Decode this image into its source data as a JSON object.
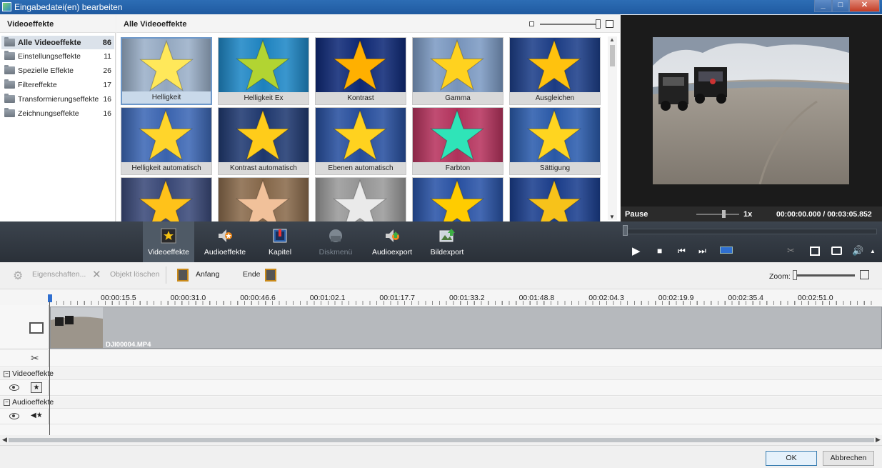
{
  "window": {
    "title": "Eingabedatei(en) bearbeiten",
    "min": "_",
    "max": "□",
    "close": "✕"
  },
  "categories": {
    "header": "Videoeffekte",
    "items": [
      {
        "label": "Alle Videoeffekte",
        "count": "86"
      },
      {
        "label": "Einstellungseffekte",
        "count": "11"
      },
      {
        "label": "Spezielle Effekte",
        "count": "26"
      },
      {
        "label": "Filtereffekte",
        "count": "17"
      },
      {
        "label": "Transformierungseffekte",
        "count": "16"
      },
      {
        "label": "Zeichnungseffekte",
        "count": "16"
      }
    ]
  },
  "grid": {
    "title": "Alle Videoeffekte",
    "tiles": [
      {
        "label": "Helligkeit",
        "bg": "#9bb0c9",
        "star": "#ffe85a"
      },
      {
        "label": "Helligkeit Ex",
        "bg": "#1f88c7",
        "star": "#b2d432"
      },
      {
        "label": "Kontrast",
        "bg": "#0f2a78",
        "star": "#ffb000"
      },
      {
        "label": "Gamma",
        "bg": "#7d9bc4",
        "star": "#ffd21f"
      },
      {
        "label": "Ausgleichen",
        "bg": "#1d3f8a",
        "star": "#ffc20e"
      },
      {
        "label": "Helligkeit automatisch",
        "bg": "#3d68b6",
        "star": "#ffd52b"
      },
      {
        "label": "Kontrast automatisch",
        "bg": "#203a72",
        "star": "#ffcc1a"
      },
      {
        "label": "Ebenen automatisch",
        "bg": "#2850a0",
        "star": "#ffd21f"
      },
      {
        "label": "Farbton",
        "bg": "#b8345f",
        "star": "#2fe4b8"
      },
      {
        "label": "Sättigung",
        "bg": "#2c5dae",
        "star": "#ffd520"
      },
      {
        "label": "",
        "bg": "#3b4a7a",
        "star": "#ffc21a"
      },
      {
        "label": "",
        "bg": "#8a6b4c",
        "star": "#f1c19a"
      },
      {
        "label": "",
        "bg": "#9a9a9a",
        "star": "#eaeaea"
      },
      {
        "label": "",
        "bg": "#2a54a8",
        "star": "#ffcc00"
      },
      {
        "label": "",
        "bg": "#1b3f8f",
        "star": "#f7c21a"
      }
    ]
  },
  "player": {
    "status": "Pause",
    "speed": "1x",
    "time": "00:00:00.000 / 00:03:05.852"
  },
  "toolbar": {
    "items": [
      {
        "label": "Videoeffekte"
      },
      {
        "label": "Audioeffekte"
      },
      {
        "label": "Kapitel"
      },
      {
        "label": "Diskmenü"
      },
      {
        "label": "Audioexport"
      },
      {
        "label": "Bildexport"
      }
    ]
  },
  "edit": {
    "properties": "Eigenschaften...",
    "delete": "Objekt löschen",
    "start": "Anfang",
    "end": "Ende",
    "zoom": "Zoom:"
  },
  "ruler": {
    "ticks": [
      "00:00:15.5",
      "00:00:31.0",
      "00:00:46.6",
      "00:01:02.1",
      "00:01:17.7",
      "00:01:33.2",
      "00:01:48.8",
      "00:02:04.3",
      "00:02:19.9",
      "00:02:35.4",
      "00:02:51.0"
    ]
  },
  "timeline": {
    "clip_name": "DJI00004.MP4",
    "video_effects": "Videoeffekte",
    "audio_effects": "Audioeffekte"
  },
  "dialog": {
    "ok": "OK",
    "cancel": "Abbrechen"
  }
}
